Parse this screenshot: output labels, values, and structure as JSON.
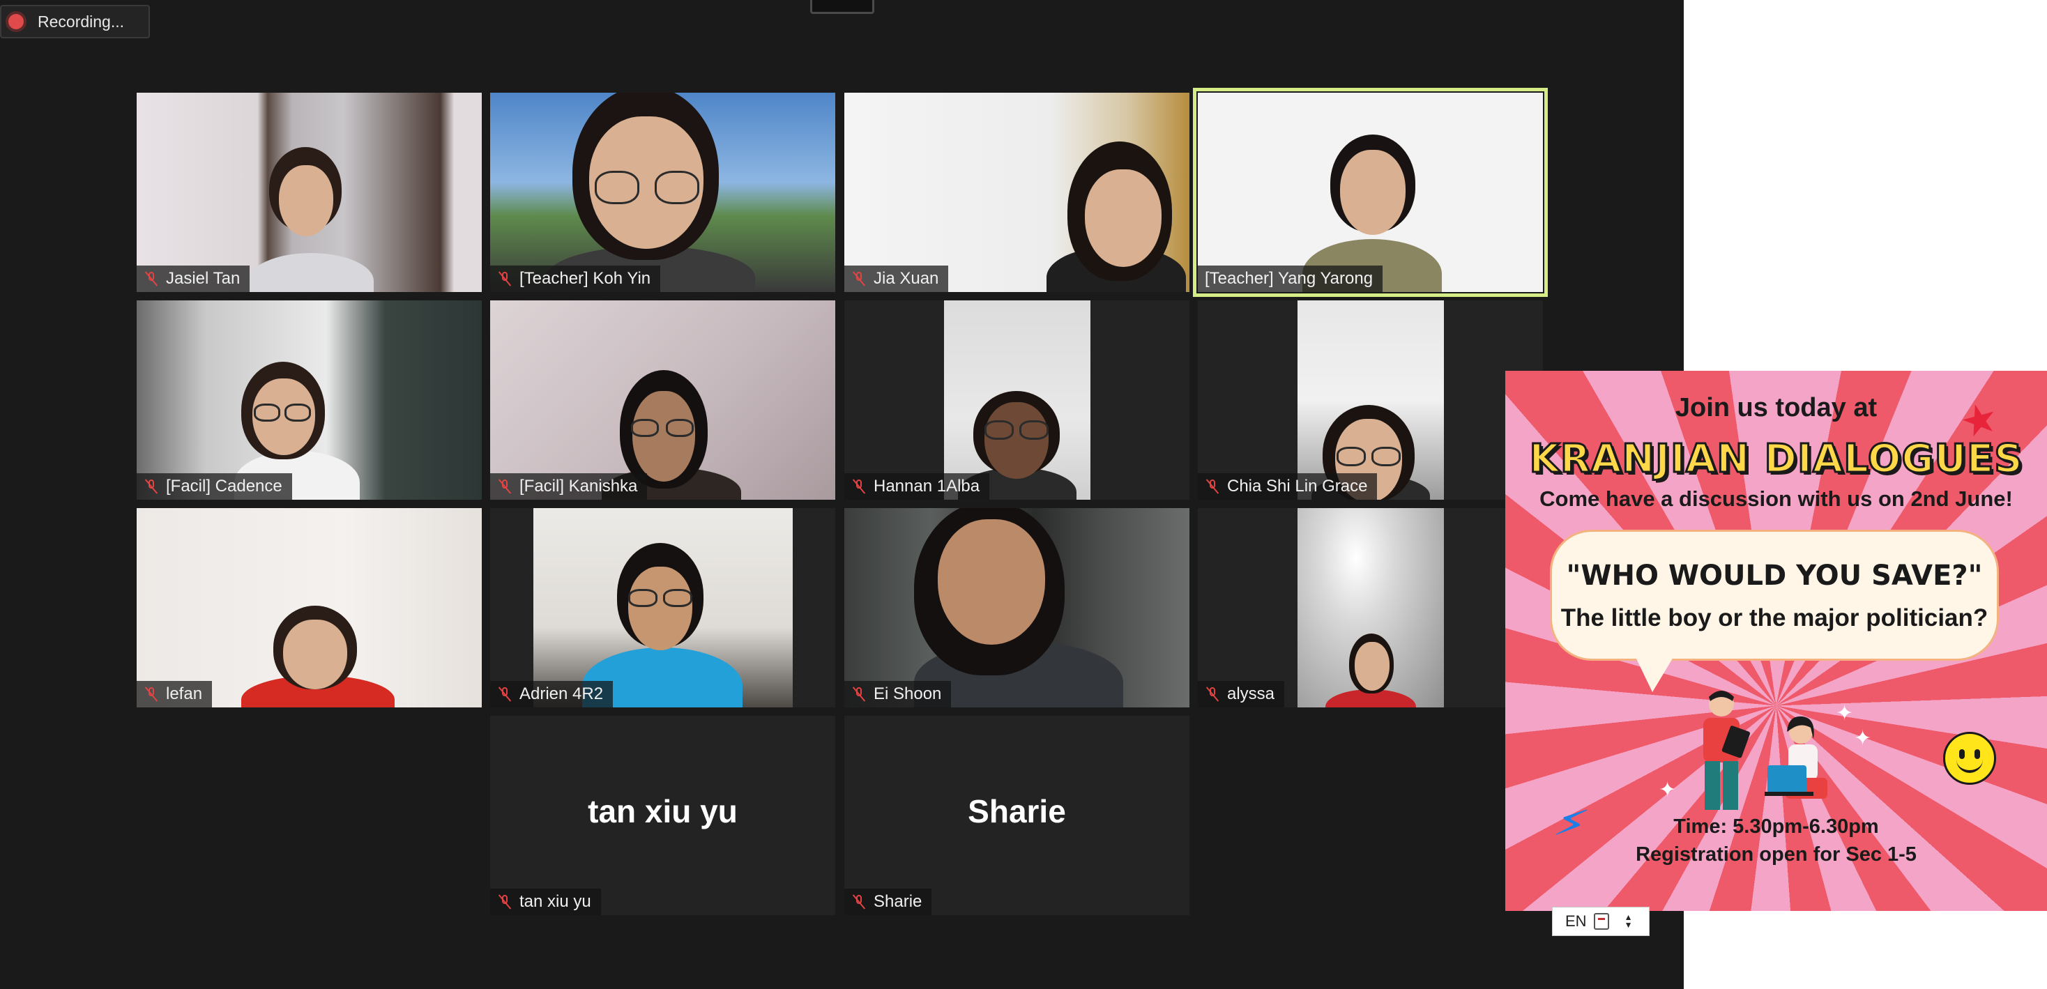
{
  "recording": {
    "label": "Recording..."
  },
  "participants": [
    {
      "name": "Jasiel Tan",
      "muted": true
    },
    {
      "name": "[Teacher] Koh Yin",
      "muted": true
    },
    {
      "name": "Jia Xuan",
      "muted": true
    },
    {
      "name": "[Teacher] Yang Yarong",
      "muted": false,
      "active_speaker": true
    },
    {
      "name": "[Facil] Cadence",
      "muted": true
    },
    {
      "name": "[Facil] Kanishka",
      "muted": true
    },
    {
      "name": "Hannan 1Alba",
      "muted": true
    },
    {
      "name": "Chia Shi Lin Grace",
      "muted": true
    },
    {
      "name": "lefan",
      "muted": true
    },
    {
      "name": "Adrien 4R2",
      "muted": true
    },
    {
      "name": "Ei Shoon",
      "muted": true
    },
    {
      "name": "alyssa",
      "muted": true
    },
    {
      "name": "tan xiu yu",
      "muted": true,
      "video_off": true,
      "display_name": "tan xiu yu"
    },
    {
      "name": "Sharie",
      "muted": true,
      "video_off": true,
      "display_name": "Sharie"
    }
  ],
  "poster": {
    "headline": "Join us today at",
    "brand": "KRANJIAN DIALOGUES",
    "subline": "Come have a discussion with us on 2nd June!",
    "question": "\"WHO WOULD YOU SAVE?\"",
    "question_sub": "The little boy or the major politician?",
    "time": "Time: 5.30pm-6.30pm",
    "registration": "Registration open for Sec 1-5",
    "colors": {
      "pink": "#f4a5c7",
      "red": "#ee5a6a",
      "yellow": "#ffd84a"
    }
  },
  "taskbar": {
    "language": "EN"
  },
  "colors": {
    "active_speaker": "#d6ec86",
    "background": "#1a1a1a",
    "mute": "#e34343"
  }
}
